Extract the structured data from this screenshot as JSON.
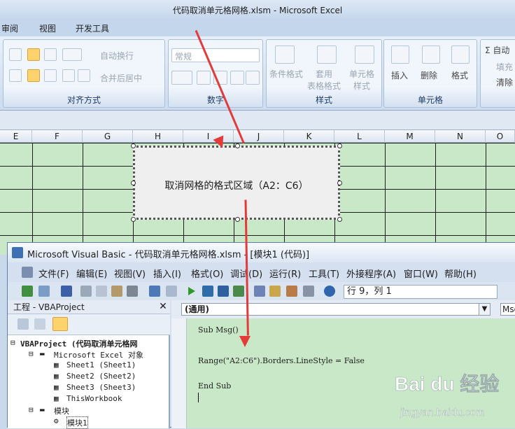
{
  "excel": {
    "window_title": "代码取消单元格网格.xlsm - Microsoft Excel",
    "tabs": [
      "审阅",
      "视图",
      "开发工具"
    ],
    "ribbon": {
      "alignment_group": "对齐方式",
      "wrap_text": "自动换行",
      "merge_center": "合并后居中",
      "number_group": "数字",
      "number_format": "常规",
      "style_group": "样式",
      "conditional_format": "条件格式",
      "table_format": "套用\n表格格式",
      "cell_style": "单元格\n样式",
      "cells_group": "单元格",
      "insert": "插入",
      "delete": "删除",
      "format": "格式",
      "autosum": "自动",
      "fill": "填充",
      "clear": "清除"
    },
    "columns": [
      "E",
      "F",
      "G",
      "H",
      "I",
      "J",
      "K",
      "L",
      "M",
      "N",
      "O"
    ],
    "shape_text": "取消网格的格式区域（A2：C6）"
  },
  "vbe": {
    "window_title": "Microsoft Visual Basic - 代码取消单元格网格.xlsm - [模块1 (代码)]",
    "menu": [
      "文件(F)",
      "编辑(E)",
      "视图(V)",
      "插入(I)",
      "格式(O)",
      "调试(D)",
      "运行(R)",
      "工具(T)",
      "外接程序(A)",
      "窗口(W)",
      "帮助(H)"
    ],
    "position": "行 9，列 1",
    "project_title": "工程 - VBAProject",
    "tree": {
      "root": "VBAProject (代码取消单元格网",
      "excel_objects": "Microsoft Excel 对象",
      "sheets": [
        "Sheet1 (Sheet1)",
        "Sheet2 (Sheet2)",
        "Sheet3 (Sheet3)"
      ],
      "workbook": "ThisWorkbook",
      "modules": "模块",
      "module1": "模块1"
    },
    "object_combo": "(通用)",
    "proc_combo": "Msg",
    "code": [
      "Sub Msg()",
      "Range(\"A2:C6\").Borders.LineStyle = False",
      "End Sub"
    ]
  },
  "watermark": {
    "brand": "Bai du 经验",
    "url": "jingyan.baidu.com"
  }
}
